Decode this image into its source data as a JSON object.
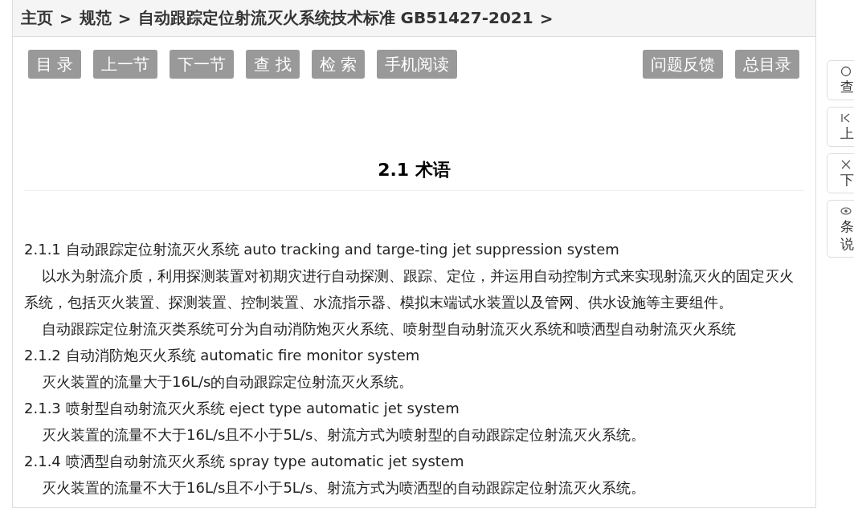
{
  "breadcrumb": [
    {
      "label": "主页"
    },
    {
      "label": "规范"
    },
    {
      "label": "自动跟踪定位射流灭火系统技术标准 GB51427-2021"
    }
  ],
  "breadcrumb_separator": ">",
  "toolbar_left": [
    "目 录",
    "上一节",
    "下一节",
    "查 找",
    "检 索",
    "手机阅读"
  ],
  "toolbar_right": [
    "问题反馈",
    "总目录"
  ],
  "heading": "2.1 术语",
  "content": [
    {
      "kind": "term",
      "text": "2.1.1 自动跟踪定位射流灭火系统 auto tracking and targe-ting jet suppression system"
    },
    {
      "kind": "para",
      "text": "以水为射流介质，利用探测装置对初期灾进行自动探测、跟踪、定位，并运用自动控制方式来实现射流灭火的固定灭火系统，包括灭火装置、探测装置、控制装置、水流指示器、模拟末端试水装置以及管网、供水设施等主要组件。"
    },
    {
      "kind": "para",
      "text": "自动跟踪定位射流灭类系统可分为自动消防炮灭火系统、喷射型自动射流灭火系统和喷洒型自动射流灭火系统"
    },
    {
      "kind": "term",
      "text": "2.1.2 自动消防炮灭火系统 automatic fire monitor system"
    },
    {
      "kind": "para",
      "text": "灭火装置的流量大于16L/s的自动跟踪定位射流灭火系统。"
    },
    {
      "kind": "term",
      "text": "2.1.3 喷射型自动射流灭火系统 eject type automatic jet system"
    },
    {
      "kind": "para",
      "text": "灭火装置的流量不大于16L/s且不小于5L/s、射流方式为喷射型的自动跟踪定位射流灭火系统。"
    },
    {
      "kind": "term",
      "text": "2.1.4 喷洒型自动射流灭火系统 spray type automatic jet system"
    },
    {
      "kind": "para",
      "text": "灭火装置的流量不大于16L/s且不小于5L/s、射流方式为喷洒型的自动跟踪定位射流灭火系统。"
    }
  ],
  "side_buttons": [
    {
      "kind": "search",
      "lines": [
        "查"
      ]
    },
    {
      "kind": "first",
      "lines": [
        "上"
      ]
    },
    {
      "kind": "close",
      "lines": [
        "下"
      ]
    },
    {
      "kind": "eye",
      "lines": [
        "条",
        "说"
      ]
    }
  ]
}
